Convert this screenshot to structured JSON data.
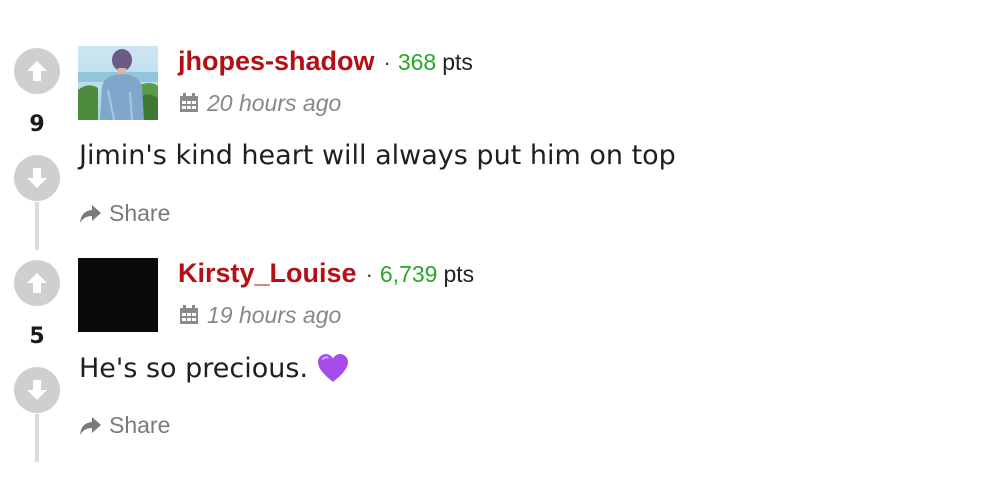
{
  "comments": [
    {
      "score": "9",
      "username": "jhopes-shadow",
      "separator": "·",
      "points": "368",
      "points_label": "pts",
      "time": "20 hours ago",
      "text": "Jimin's kind heart will always put him on top",
      "share_label": "Share",
      "avatar": "photo-person-outdoors"
    },
    {
      "score": "5",
      "username": "Kirsty_Louise",
      "separator": "·",
      "points": "6,739",
      "points_label": "pts",
      "time": "19 hours ago",
      "text": "He's so precious.",
      "emoji": "purple-heart-icon",
      "share_label": "Share",
      "avatar": "black-square"
    }
  ],
  "colors": {
    "username": "#b30f14",
    "points": "#2aa52a",
    "vote_button": "#cfcfcf",
    "muted": "#888888"
  },
  "icons": {
    "upvote": "arrow-up-icon",
    "downvote": "arrow-down-icon",
    "calendar": "calendar-icon",
    "share": "share-arrow-icon"
  }
}
